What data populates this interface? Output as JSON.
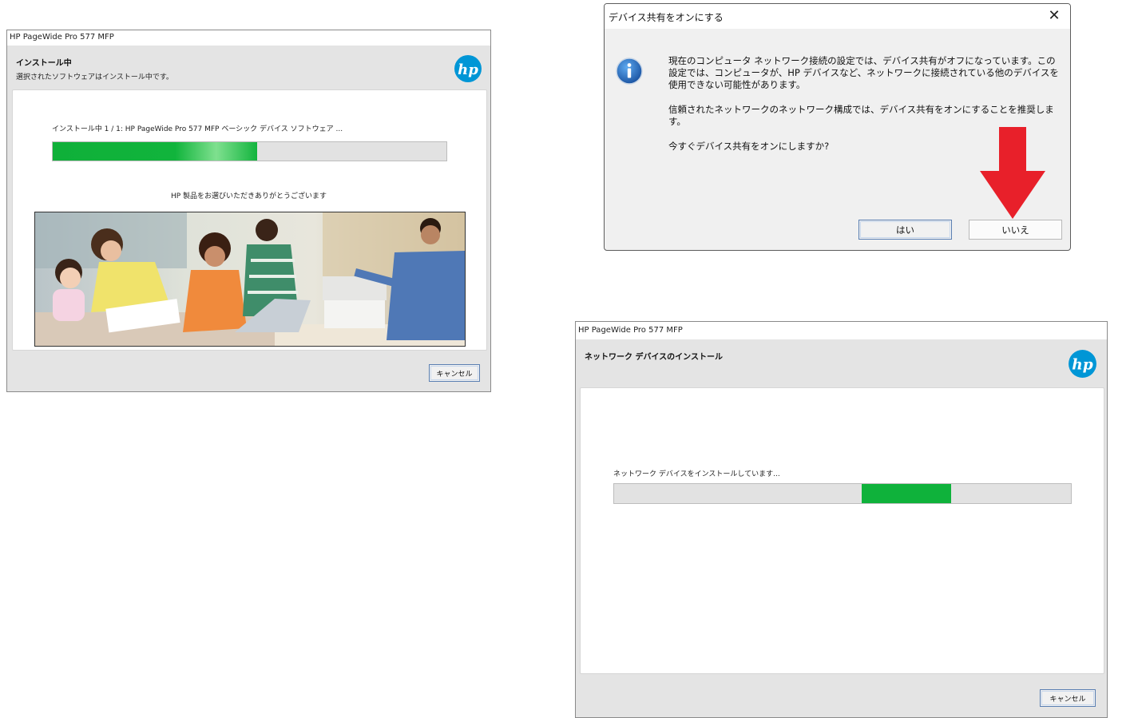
{
  "installer": {
    "title": "HP PageWide Pro 577 MFP",
    "header_title": "インストール中",
    "header_subtitle": "選択されたソフトウェアはインストール中です。",
    "status": "インストール中 1 / 1: HP PageWide Pro 577 MFP ベーシック デバイス ソフトウェア ...",
    "progress": 0.52,
    "thanks": "HP 製品をお選びいただきありがとうございます",
    "cancel_label": "キャンセル",
    "logo": "hp-logo"
  },
  "dialog": {
    "title": "デバイス共有をオンにする",
    "close_icon": "close-icon",
    "icon": "info-icon",
    "message1": "現在のコンピュータ ネットワーク接続の設定では、デバイス共有がオフになっています。この設定では、コンピュータが、HP デバイスなど、ネットワークに接続されている他のデバイスを使用できない可能性があります。",
    "message2": "信頼されたネットワークのネットワーク構成では、デバイス共有をオンにすることを推奨します。",
    "message3": "今すぐデバイス共有をオンにしますか?",
    "yes_label": "はい",
    "no_label": "いいえ",
    "annotation": "red-arrow-pointing-to-no",
    "annotation_color": "#e8202a"
  },
  "network_install": {
    "title": "HP PageWide Pro 577 MFP",
    "header_title": "ネットワーク デバイスのインストール",
    "status": "ネットワーク デバイスをインストールしています...",
    "progress_indicator": "indeterminate",
    "cancel_label": "キャンセル",
    "logo": "hp-logo"
  },
  "colors": {
    "progress_green": "#0fb23b",
    "hp_blue": "#0096d6",
    "info_blue": "#1a6fc4"
  }
}
